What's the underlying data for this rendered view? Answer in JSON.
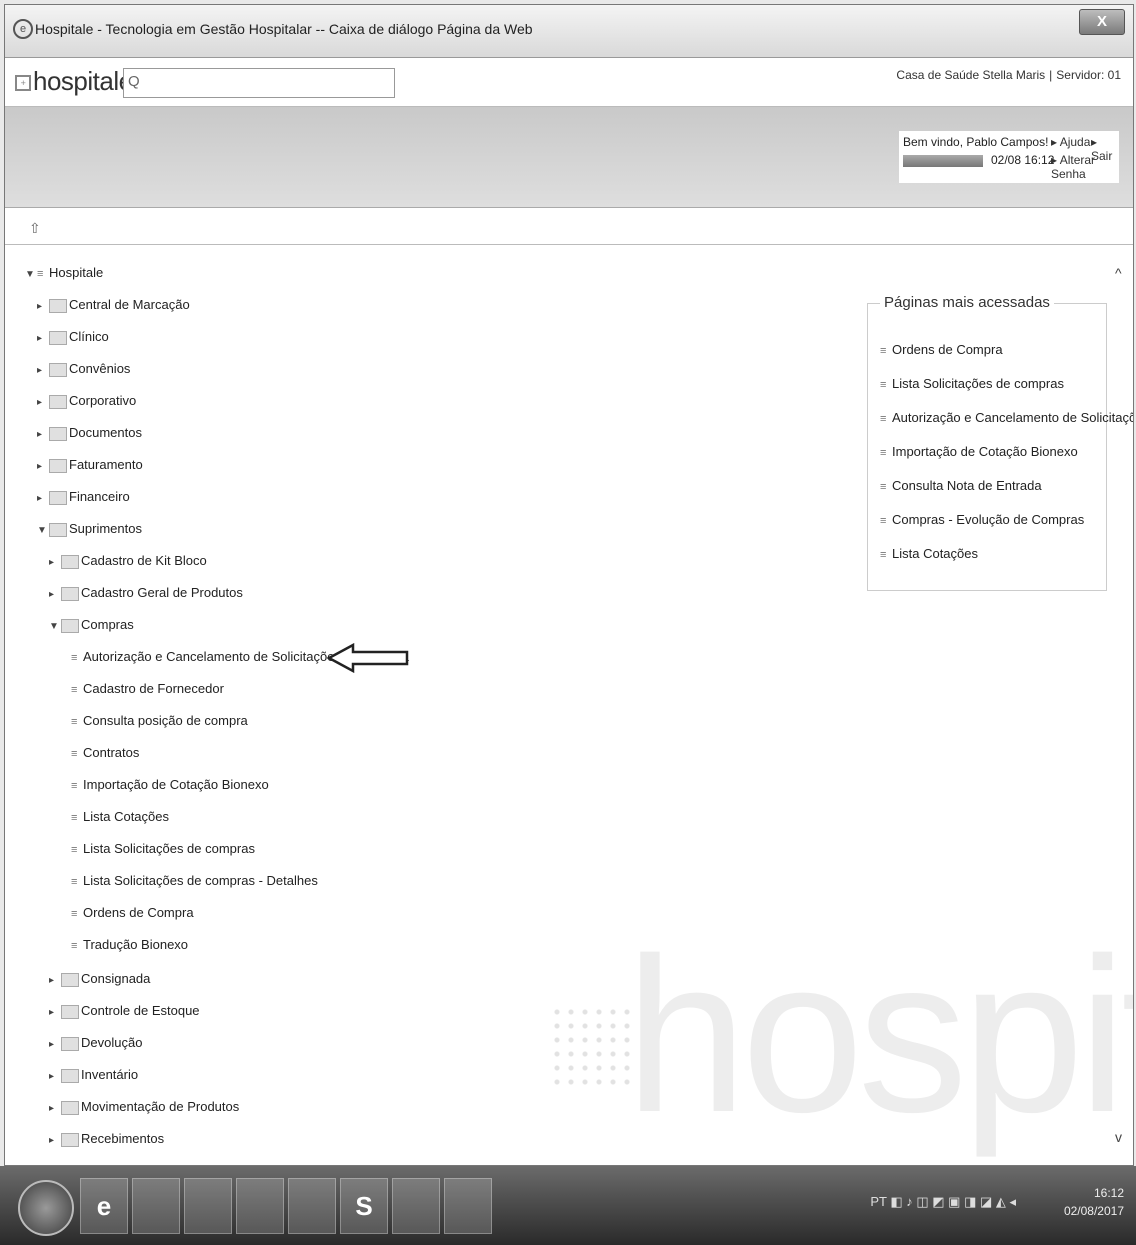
{
  "window": {
    "title": "Hospitale - Tecnologia em Gestão Hospitalar -- Caixa de diálogo Página da Web",
    "close_label": "X"
  },
  "header": {
    "logo": "hospitale",
    "search_placeholder": "",
    "company": "Casa de Saúde Stella Maris",
    "server": "Servidor: 01"
  },
  "user": {
    "welcome": "Bem vindo, Pablo Campos!",
    "time": "02/08 16:12",
    "links": [
      "Ajuda",
      "Sair",
      "Alterar Senha"
    ]
  },
  "tree": {
    "root": "Hospitale",
    "top_folders": [
      "Central de Marcação",
      "Clínico",
      "Convênios",
      "Corporativo",
      "Documentos",
      "Faturamento",
      "Financeiro"
    ],
    "suprimentos": "Suprimentos",
    "sup_folders_before": [
      "Cadastro de Kit Bloco",
      "Cadastro Geral de Produtos"
    ],
    "compras": "Compras",
    "compras_pages": [
      "Autorização e Cancelamento de Solicitações de Compra",
      "Cadastro de Fornecedor",
      "Consulta posição de compra",
      "Contratos",
      "Importação de Cotação Bionexo",
      "Lista Cotações",
      "Lista Solicitações de compras",
      "Lista Solicitações de compras - Detalhes",
      "Ordens de Compra",
      "Tradução Bionexo"
    ],
    "sup_folders_after": [
      "Consignada",
      "Controle de Estoque",
      "Devolução",
      "Inventário",
      "Movimentação de Produtos",
      "Recebimentos"
    ]
  },
  "most_visited": {
    "title": "Páginas mais acessadas",
    "items": [
      "Ordens de Compra",
      "Lista Solicitações de compras",
      "Autorização e Cancelamento de Solicitações...",
      "Importação de Cotação Bionexo",
      "Consulta Nota de Entrada",
      "Compras - Evolução de Compras",
      "Lista Cotações"
    ]
  },
  "watermark": "hospitale",
  "taskbar": {
    "apps": [
      "e",
      "",
      "",
      "",
      "",
      "S",
      "",
      ""
    ],
    "clock_time": "16:12",
    "clock_date": "02/08/2017",
    "tray_lang": "PT"
  }
}
